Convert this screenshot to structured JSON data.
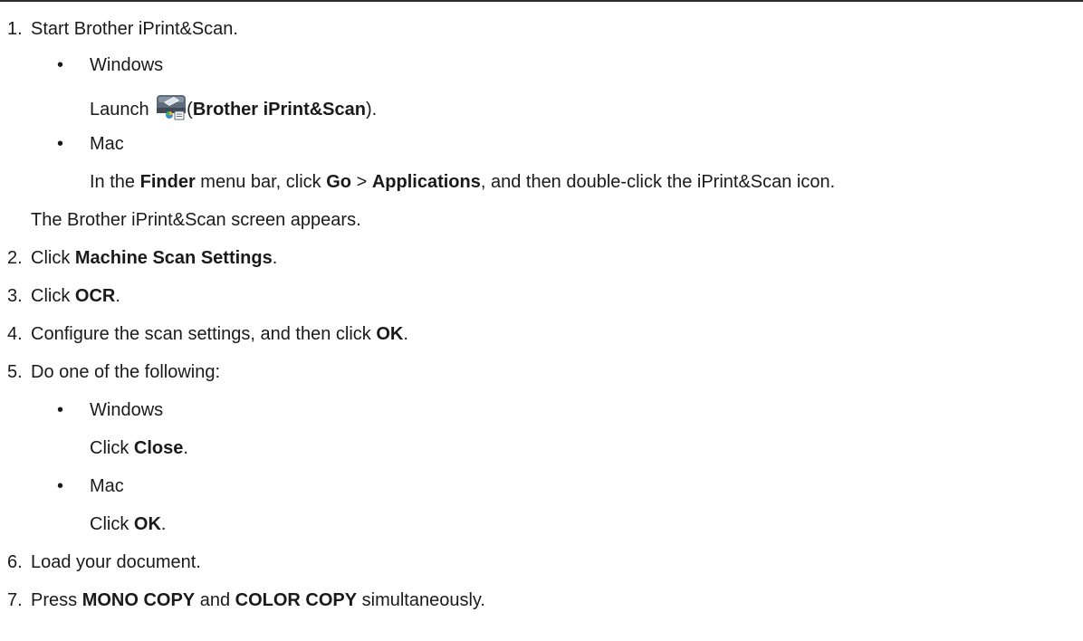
{
  "steps": [
    {
      "num": "1.",
      "text": "Start Brother iPrint&Scan."
    },
    {
      "num": "2.",
      "pre": "Click ",
      "bold": "Machine Scan Settings",
      "post": "."
    },
    {
      "num": "3.",
      "pre": "Click ",
      "bold": "OCR",
      "post": "."
    },
    {
      "num": "4.",
      "pre": "Configure the scan settings, and then click ",
      "bold": "OK",
      "post": "."
    },
    {
      "num": "5.",
      "text": "Do one of the following:"
    },
    {
      "num": "6.",
      "text": "Load your document."
    },
    {
      "num": "7.",
      "pre": "Press ",
      "bold1": "MONO COPY",
      "mid": " and ",
      "bold2": "COLOR COPY",
      "post": " simultaneously."
    }
  ],
  "step1": {
    "windows": {
      "bullet": "•",
      "label": "Windows",
      "launch_pre": "Launch ",
      "launch_icon": "brother-iprint-scan-icon",
      "launch_paren_open": "(",
      "launch_bold": "Brother iPrint&Scan",
      "launch_post": ")."
    },
    "mac": {
      "bullet": "•",
      "label": "Mac",
      "t1": "In the ",
      "b1": "Finder",
      "t2": " menu bar, click ",
      "b2": "Go",
      "t3": " > ",
      "b3": "Applications",
      "t4": ", and then double-click the iPrint&Scan icon."
    },
    "result": "The Brother iPrint&Scan screen appears."
  },
  "step5": {
    "windows": {
      "bullet": "•",
      "label": "Windows",
      "pre": "Click ",
      "bold": "Close",
      "post": "."
    },
    "mac": {
      "bullet": "•",
      "label": "Mac",
      "pre": "Click ",
      "bold": "OK",
      "post": "."
    }
  }
}
